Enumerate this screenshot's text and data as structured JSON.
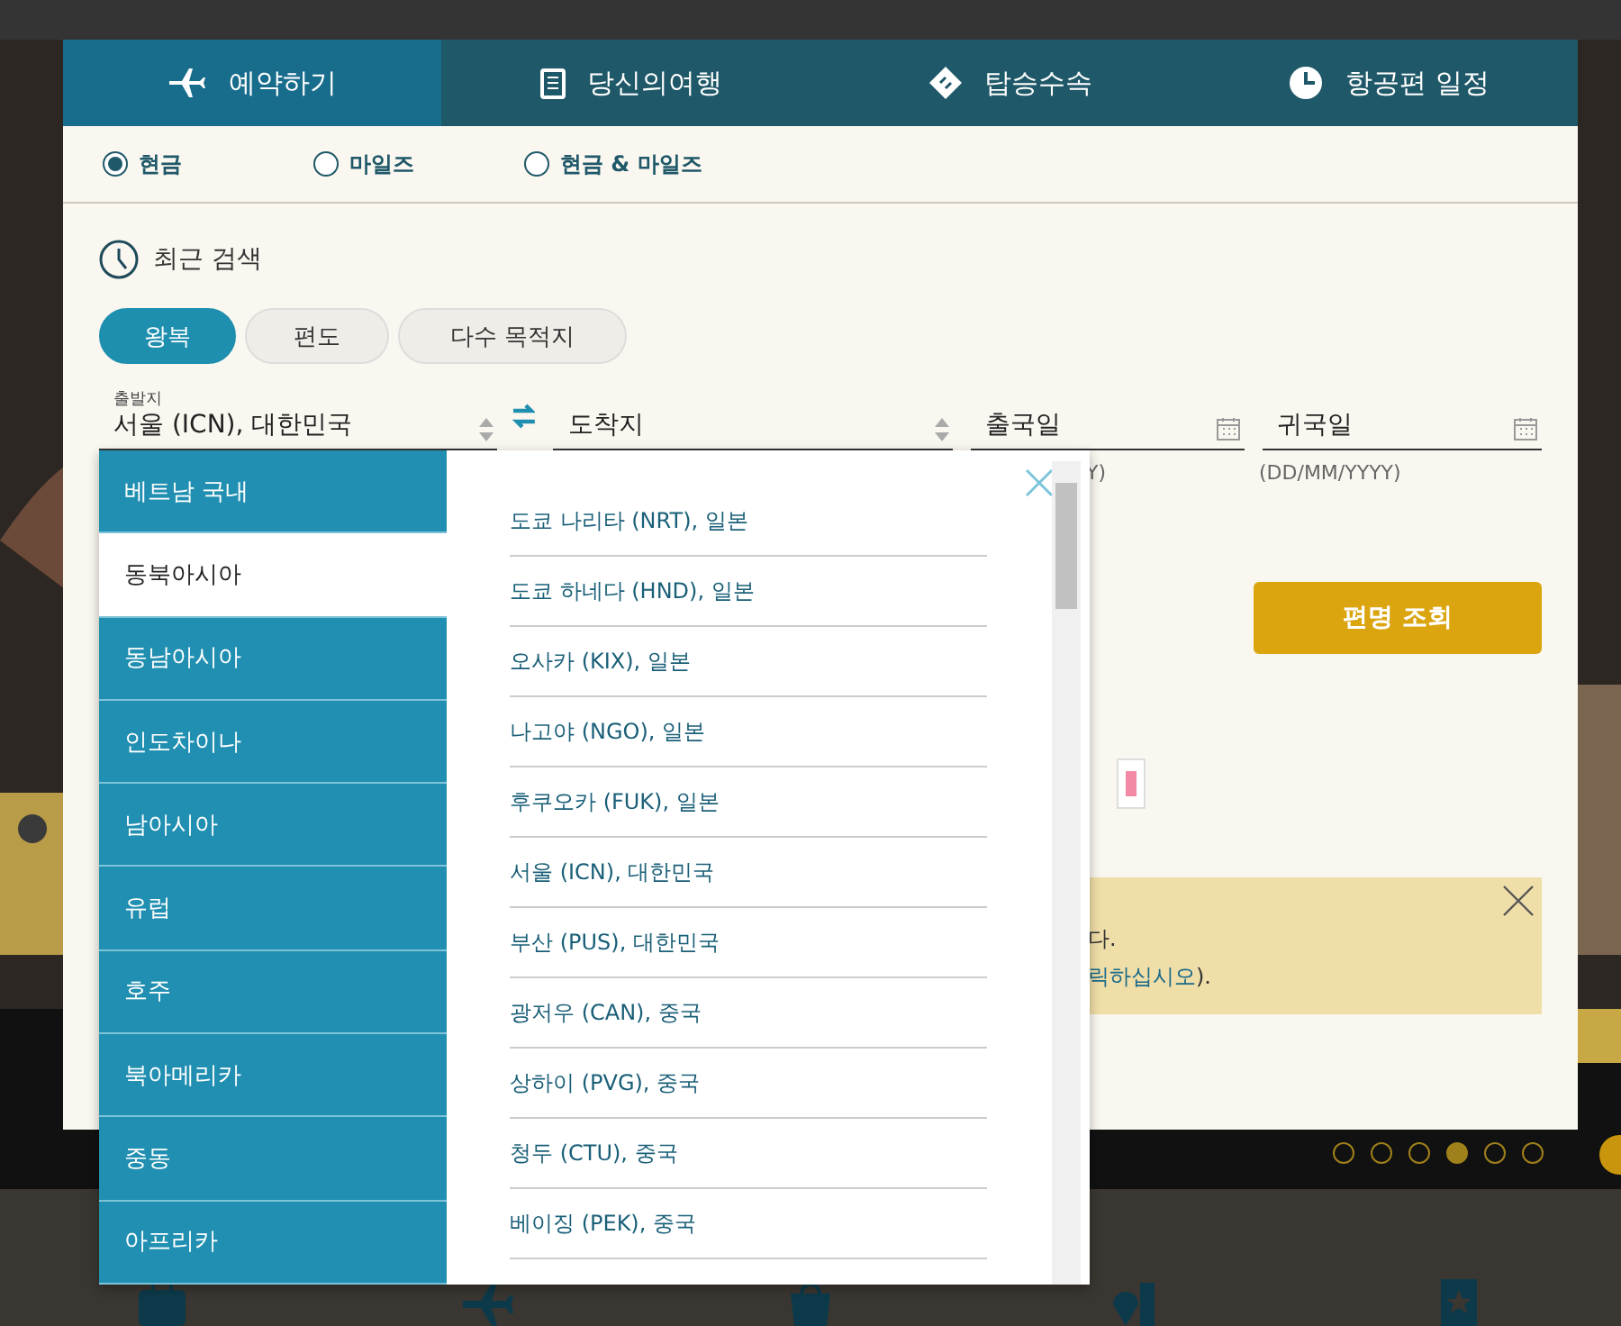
{
  "tabs": [
    {
      "label": "예약하기",
      "kind": "plane",
      "selected": true
    },
    {
      "label": "당신의여행",
      "kind": "book",
      "selected": false
    },
    {
      "label": "탑승수속",
      "kind": "ticket",
      "selected": false
    },
    {
      "label": "항공편 일정",
      "kind": "clock",
      "selected": false
    }
  ],
  "payment_options": [
    {
      "label": "현금",
      "selected": true
    },
    {
      "label": "마일즈",
      "selected": false
    },
    {
      "label": "현금 & 마일즈",
      "selected": false
    }
  ],
  "recent_search": {
    "label": "최근 검색"
  },
  "trip_types": [
    {
      "label": "왕복",
      "selected": true
    },
    {
      "label": "편도",
      "selected": false
    },
    {
      "label": "다수 목적지",
      "selected": false
    }
  ],
  "origin": {
    "label": "출발지",
    "value": "서울 (ICN), 대한민국"
  },
  "destination": {
    "placeholder": "도착지"
  },
  "departure_date": {
    "placeholder": "출국일",
    "hint": "Y)"
  },
  "return_date": {
    "placeholder": "귀국일",
    "hint": "(DD/MM/YYYY)"
  },
  "search_button": {
    "label": "편명 조회"
  },
  "notice": {
    "line_1": "다.",
    "line_2_link": "릭하십시오",
    "line_2_end": ")."
  },
  "region_menu": [
    {
      "label": "베트남 국내",
      "selected": false
    },
    {
      "label": "동북아시아",
      "selected": true
    },
    {
      "label": "동남아시아",
      "selected": false
    },
    {
      "label": "인도차이나",
      "selected": false
    },
    {
      "label": "남아시아",
      "selected": false
    },
    {
      "label": "유럽",
      "selected": false
    },
    {
      "label": "호주",
      "selected": false
    },
    {
      "label": "북아메리카",
      "selected": false
    },
    {
      "label": "중동",
      "selected": false
    },
    {
      "label": "아프리카",
      "selected": false
    }
  ],
  "airports": [
    "도쿄 나리타 (NRT), 일본",
    "도쿄 하네다 (HND), 일본",
    "오사카 (KIX), 일본",
    "나고야 (NGO), 일본",
    "후쿠오카 (FUK), 일본",
    "서울 (ICN), 대한민국",
    "부산 (PUS), 대한민국",
    "광저우 (CAN), 중국",
    "상하이 (PVG), 중국",
    "청두 (CTU), 중국",
    "베이징 (PEK), 중국"
  ],
  "carousel": {
    "dots": [
      {
        "selected": false
      },
      {
        "selected": false
      },
      {
        "selected": false
      },
      {
        "selected": true
      },
      {
        "selected": false
      },
      {
        "selected": false
      }
    ]
  }
}
